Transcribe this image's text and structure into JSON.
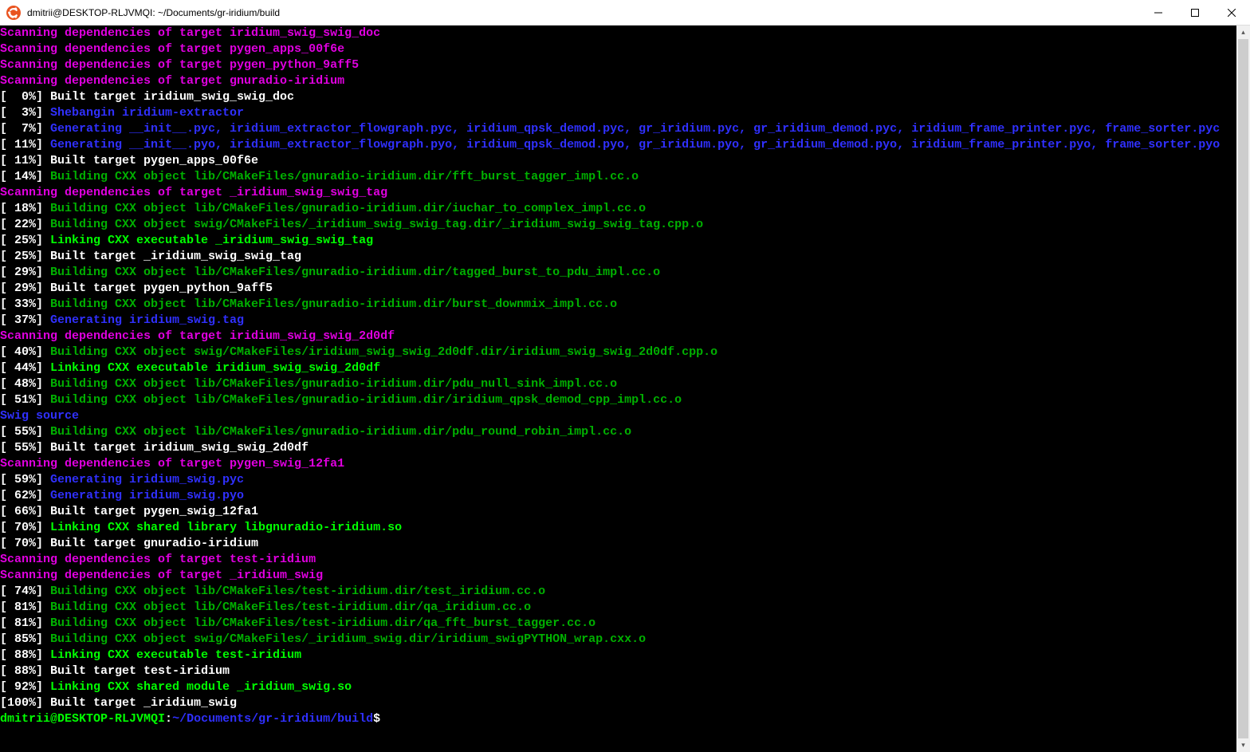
{
  "window": {
    "title": "dmitrii@DESKTOP-RLJVMQI: ~/Documents/gr-iridium/build"
  },
  "prompt": {
    "user_host": "dmitrii@DESKTOP-RLJVMQI",
    "sep": ":",
    "path": "~/Documents/gr-iridium/build",
    "symbol": "$"
  },
  "lines": [
    {
      "spans": [
        {
          "c": "magenta",
          "t": "Scanning dependencies of target iridium_swig_swig_doc"
        }
      ]
    },
    {
      "spans": [
        {
          "c": "magenta",
          "t": "Scanning dependencies of target pygen_apps_00f6e"
        }
      ]
    },
    {
      "spans": [
        {
          "c": "magenta",
          "t": "Scanning dependencies of target pygen_python_9aff5"
        }
      ]
    },
    {
      "spans": [
        {
          "c": "magenta",
          "t": "Scanning dependencies of target gnuradio-iridium"
        }
      ]
    },
    {
      "spans": [
        {
          "c": "white",
          "t": "[  0%] Built target iridium_swig_swig_doc"
        }
      ]
    },
    {
      "spans": [
        {
          "c": "white",
          "t": "[  3%] "
        },
        {
          "c": "blue",
          "t": "Shebangin iridium-extractor"
        }
      ]
    },
    {
      "spans": [
        {
          "c": "white",
          "t": "[  7%] "
        },
        {
          "c": "blue",
          "t": "Generating __init__.pyc, iridium_extractor_flowgraph.pyc, iridium_qpsk_demod.pyc, gr_iridium.pyc, gr_iridium_demod.pyc, iridium_frame_printer.pyc, frame_sorter.pyc"
        }
      ]
    },
    {
      "spans": [
        {
          "c": "white",
          "t": "[ 11%] "
        },
        {
          "c": "blue",
          "t": "Generating __init__.pyo, iridium_extractor_flowgraph.pyo, iridium_qpsk_demod.pyo, gr_iridium.pyo, gr_iridium_demod.pyo, iridium_frame_printer.pyo, frame_sorter.pyo"
        }
      ]
    },
    {
      "spans": [
        {
          "c": "white",
          "t": "[ 11%] Built target pygen_apps_00f6e"
        }
      ]
    },
    {
      "spans": [
        {
          "c": "white",
          "t": "[ 14%] "
        },
        {
          "c": "green",
          "t": "Building CXX object lib/CMakeFiles/gnuradio-iridium.dir/fft_burst_tagger_impl.cc.o"
        }
      ]
    },
    {
      "spans": [
        {
          "c": "magenta",
          "t": "Scanning dependencies of target _iridium_swig_swig_tag"
        }
      ]
    },
    {
      "spans": [
        {
          "c": "white",
          "t": "[ 18%] "
        },
        {
          "c": "green",
          "t": "Building CXX object lib/CMakeFiles/gnuradio-iridium.dir/iuchar_to_complex_impl.cc.o"
        }
      ]
    },
    {
      "spans": [
        {
          "c": "white",
          "t": "[ 22%] "
        },
        {
          "c": "green",
          "t": "Building CXX object swig/CMakeFiles/_iridium_swig_swig_tag.dir/_iridium_swig_swig_tag.cpp.o"
        }
      ]
    },
    {
      "spans": [
        {
          "c": "white",
          "t": "[ 25%] "
        },
        {
          "c": "brightgreen",
          "t": "Linking CXX executable _iridium_swig_swig_tag"
        }
      ]
    },
    {
      "spans": [
        {
          "c": "white",
          "t": "[ 25%] Built target _iridium_swig_swig_tag"
        }
      ]
    },
    {
      "spans": [
        {
          "c": "white",
          "t": "[ 29%] "
        },
        {
          "c": "green",
          "t": "Building CXX object lib/CMakeFiles/gnuradio-iridium.dir/tagged_burst_to_pdu_impl.cc.o"
        }
      ]
    },
    {
      "spans": [
        {
          "c": "white",
          "t": "[ 29%] Built target pygen_python_9aff5"
        }
      ]
    },
    {
      "spans": [
        {
          "c": "white",
          "t": "[ 33%] "
        },
        {
          "c": "green",
          "t": "Building CXX object lib/CMakeFiles/gnuradio-iridium.dir/burst_downmix_impl.cc.o"
        }
      ]
    },
    {
      "spans": [
        {
          "c": "white",
          "t": "[ 37%] "
        },
        {
          "c": "blue",
          "t": "Generating iridium_swig.tag"
        }
      ]
    },
    {
      "spans": [
        {
          "c": "magenta",
          "t": "Scanning dependencies of target iridium_swig_swig_2d0df"
        }
      ]
    },
    {
      "spans": [
        {
          "c": "white",
          "t": "[ 40%] "
        },
        {
          "c": "green",
          "t": "Building CXX object swig/CMakeFiles/iridium_swig_swig_2d0df.dir/iridium_swig_swig_2d0df.cpp.o"
        }
      ]
    },
    {
      "spans": [
        {
          "c": "white",
          "t": "[ 44%] "
        },
        {
          "c": "brightgreen",
          "t": "Linking CXX executable iridium_swig_swig_2d0df"
        }
      ]
    },
    {
      "spans": [
        {
          "c": "white",
          "t": "[ 48%] "
        },
        {
          "c": "green",
          "t": "Building CXX object lib/CMakeFiles/gnuradio-iridium.dir/pdu_null_sink_impl.cc.o"
        }
      ]
    },
    {
      "spans": [
        {
          "c": "white",
          "t": "[ 51%] "
        },
        {
          "c": "green",
          "t": "Building CXX object lib/CMakeFiles/gnuradio-iridium.dir/iridium_qpsk_demod_cpp_impl.cc.o"
        }
      ]
    },
    {
      "spans": [
        {
          "c": "blue",
          "t": "Swig source"
        }
      ]
    },
    {
      "spans": [
        {
          "c": "white",
          "t": "[ 55%] "
        },
        {
          "c": "green",
          "t": "Building CXX object lib/CMakeFiles/gnuradio-iridium.dir/pdu_round_robin_impl.cc.o"
        }
      ]
    },
    {
      "spans": [
        {
          "c": "white",
          "t": "[ 55%] Built target iridium_swig_swig_2d0df"
        }
      ]
    },
    {
      "spans": [
        {
          "c": "magenta",
          "t": "Scanning dependencies of target pygen_swig_12fa1"
        }
      ]
    },
    {
      "spans": [
        {
          "c": "white",
          "t": "[ 59%] "
        },
        {
          "c": "blue",
          "t": "Generating iridium_swig.pyc"
        }
      ]
    },
    {
      "spans": [
        {
          "c": "white",
          "t": "[ 62%] "
        },
        {
          "c": "blue",
          "t": "Generating iridium_swig.pyo"
        }
      ]
    },
    {
      "spans": [
        {
          "c": "white",
          "t": "[ 66%] Built target pygen_swig_12fa1"
        }
      ]
    },
    {
      "spans": [
        {
          "c": "white",
          "t": "[ 70%] "
        },
        {
          "c": "brightgreen",
          "t": "Linking CXX shared library libgnuradio-iridium.so"
        }
      ]
    },
    {
      "spans": [
        {
          "c": "white",
          "t": "[ 70%] Built target gnuradio-iridium"
        }
      ]
    },
    {
      "spans": [
        {
          "c": "magenta",
          "t": "Scanning dependencies of target test-iridium"
        }
      ]
    },
    {
      "spans": [
        {
          "c": "magenta",
          "t": "Scanning dependencies of target _iridium_swig"
        }
      ]
    },
    {
      "spans": [
        {
          "c": "white",
          "t": "[ 74%] "
        },
        {
          "c": "green",
          "t": "Building CXX object lib/CMakeFiles/test-iridium.dir/test_iridium.cc.o"
        }
      ]
    },
    {
      "spans": [
        {
          "c": "white",
          "t": "[ 81%] "
        },
        {
          "c": "green",
          "t": "Building CXX object lib/CMakeFiles/test-iridium.dir/qa_iridium.cc.o"
        }
      ]
    },
    {
      "spans": [
        {
          "c": "white",
          "t": "[ 81%] "
        },
        {
          "c": "green",
          "t": "Building CXX object lib/CMakeFiles/test-iridium.dir/qa_fft_burst_tagger.cc.o"
        }
      ]
    },
    {
      "spans": [
        {
          "c": "white",
          "t": "[ 85%] "
        },
        {
          "c": "green",
          "t": "Building CXX object swig/CMakeFiles/_iridium_swig.dir/iridium_swigPYTHON_wrap.cxx.o"
        }
      ]
    },
    {
      "spans": [
        {
          "c": "white",
          "t": "[ 88%] "
        },
        {
          "c": "brightgreen",
          "t": "Linking CXX executable test-iridium"
        }
      ]
    },
    {
      "spans": [
        {
          "c": "white",
          "t": "[ 88%] Built target test-iridium"
        }
      ]
    },
    {
      "spans": [
        {
          "c": "white",
          "t": "[ 92%] "
        },
        {
          "c": "brightgreen",
          "t": "Linking CXX shared module _iridium_swig.so"
        }
      ]
    },
    {
      "spans": [
        {
          "c": "white",
          "t": "[100%] Built target _iridium_swig"
        }
      ]
    }
  ]
}
